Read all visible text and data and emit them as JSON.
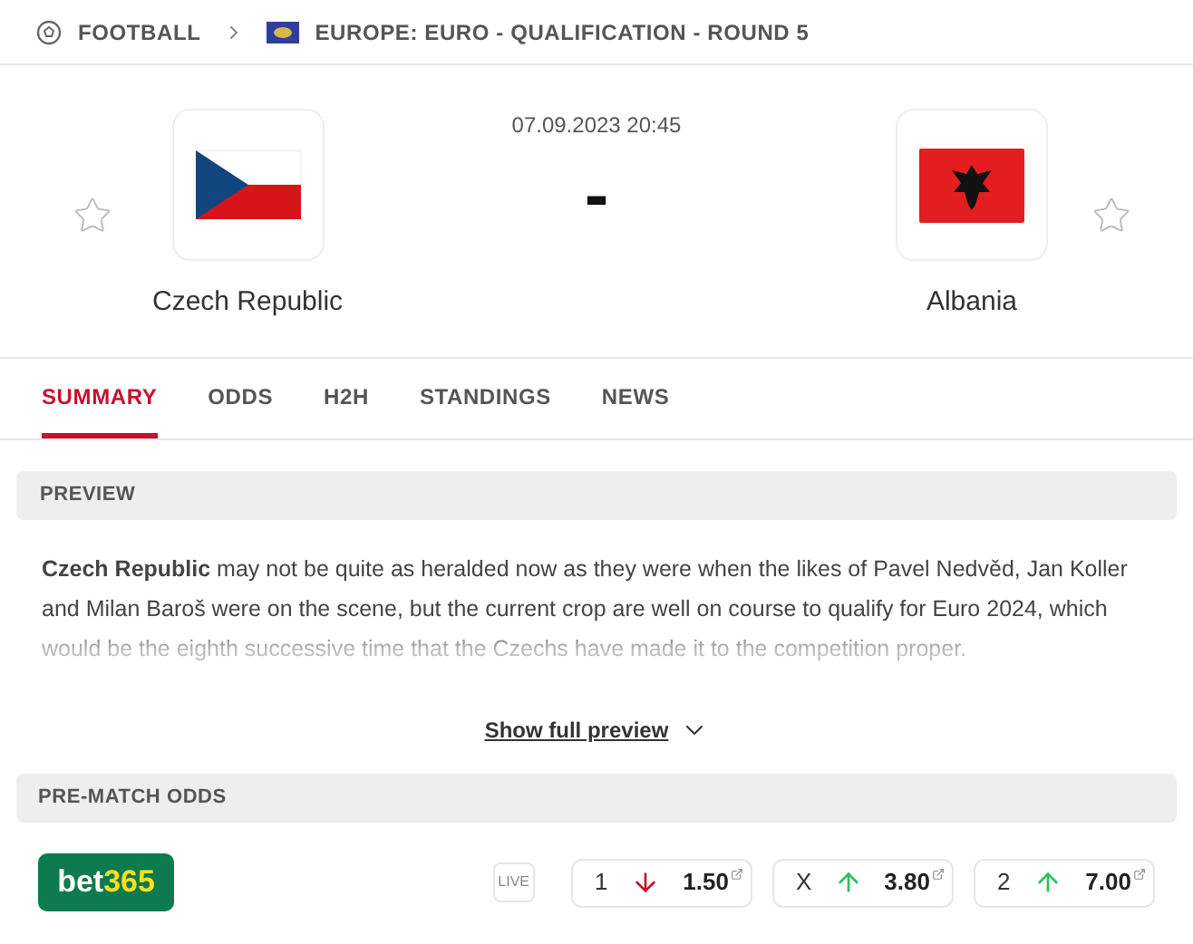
{
  "breadcrumb": {
    "sport": "FOOTBALL",
    "league": "EUROPE: EURO - QUALIFICATION - ROUND 5"
  },
  "match": {
    "datetime": "07.09.2023 20:45",
    "score": "-",
    "home": {
      "name": "Czech Republic",
      "favorite": false
    },
    "away": {
      "name": "Albania",
      "favorite": false
    }
  },
  "tabs": [
    {
      "label": "SUMMARY",
      "selected": true
    },
    {
      "label": "ODDS",
      "selected": false
    },
    {
      "label": "H2H",
      "selected": false
    },
    {
      "label": "STANDINGS",
      "selected": false
    },
    {
      "label": "NEWS",
      "selected": false
    }
  ],
  "preview": {
    "title": "PREVIEW",
    "text": "**Czech Republic** may not be quite as heralded now as they were when the likes of Pavel Nedvěd, Jan Koller and Milan Baroš were on the scene, but the current crop are well on course to qualify for Euro 2024, which would be the eighth successive time that the Czechs have made it to the competition proper.",
    "more": "Show full preview"
  },
  "odds": {
    "title": "PRE-MATCH ODDS",
    "bookmaker": {
      "part1": "bet",
      "part2": "365"
    },
    "live": "LIVE",
    "items": [
      {
        "label": "1",
        "value": "1.50",
        "rising": false
      },
      {
        "label": "X",
        "value": "3.80",
        "rising": true
      },
      {
        "label": "2",
        "value": "7.00",
        "rising": true
      }
    ]
  }
}
